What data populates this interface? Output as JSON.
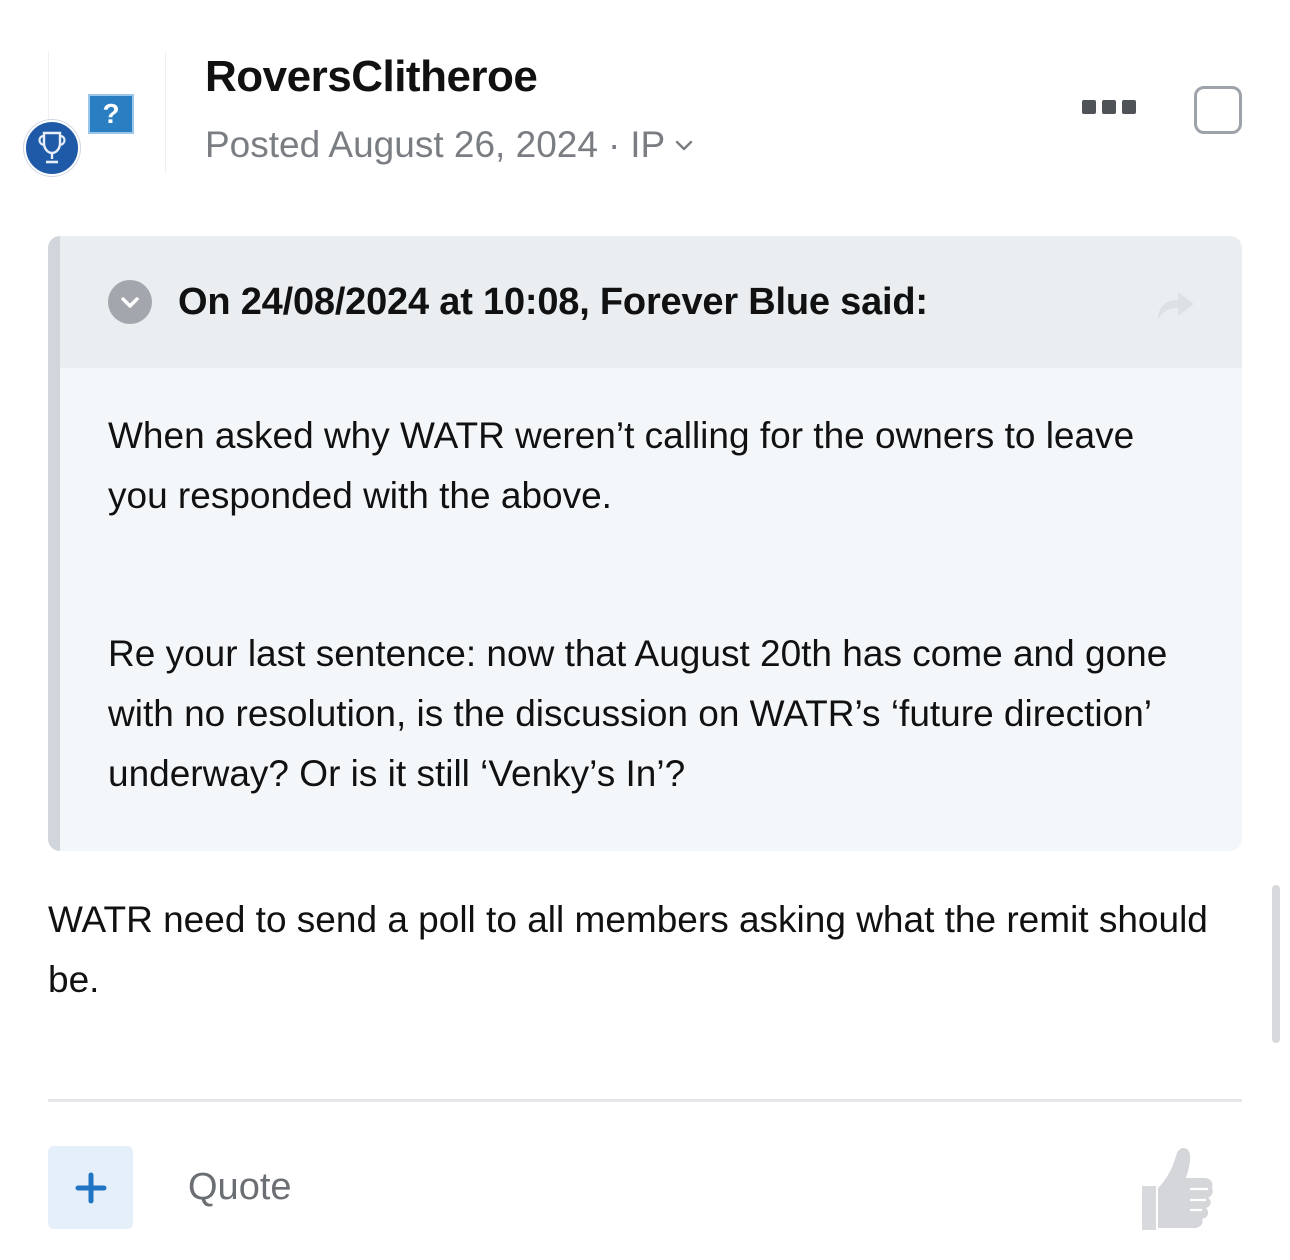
{
  "post": {
    "author": "RoversClitheroe",
    "posted_label": "Posted August 26, 2024",
    "separator": "·",
    "ip_label": "IP"
  },
  "icons": {
    "avatar": "missing-image-icon",
    "badge": "trophy-icon",
    "menu": "more-options-icon",
    "select": "checkbox-icon",
    "toggle": "chevron-down-circle-icon",
    "share": "share-arrow-icon",
    "add": "plus-icon",
    "like": "thumbs-up-icon"
  },
  "avatar": {
    "glyph": "?"
  },
  "quote": {
    "citation": "On 24/08/2024 at 10:08, Forever Blue said:",
    "paragraphs": [
      "When asked why WATR weren’t calling for the owners to leave you responded with the above.",
      "Re your last sentence: now that August 20th has come and gone with no resolution, is the discussion on WATR’s ‘future direction’ underway? Or is it still ‘Venky’s In’?"
    ]
  },
  "content": {
    "text": "WATR need to send a poll to all members asking what the remit should be."
  },
  "actions": {
    "add_symbol": "+",
    "quote_label": "Quote"
  },
  "colors": {
    "accent": "#1f74c4",
    "badge": "#1f5aa8",
    "quote_bg": "#f4f7fa",
    "quote_head_bg": "#ebeef1",
    "quote_border": "#d1d6dc",
    "meta_text": "#7a7d82"
  }
}
